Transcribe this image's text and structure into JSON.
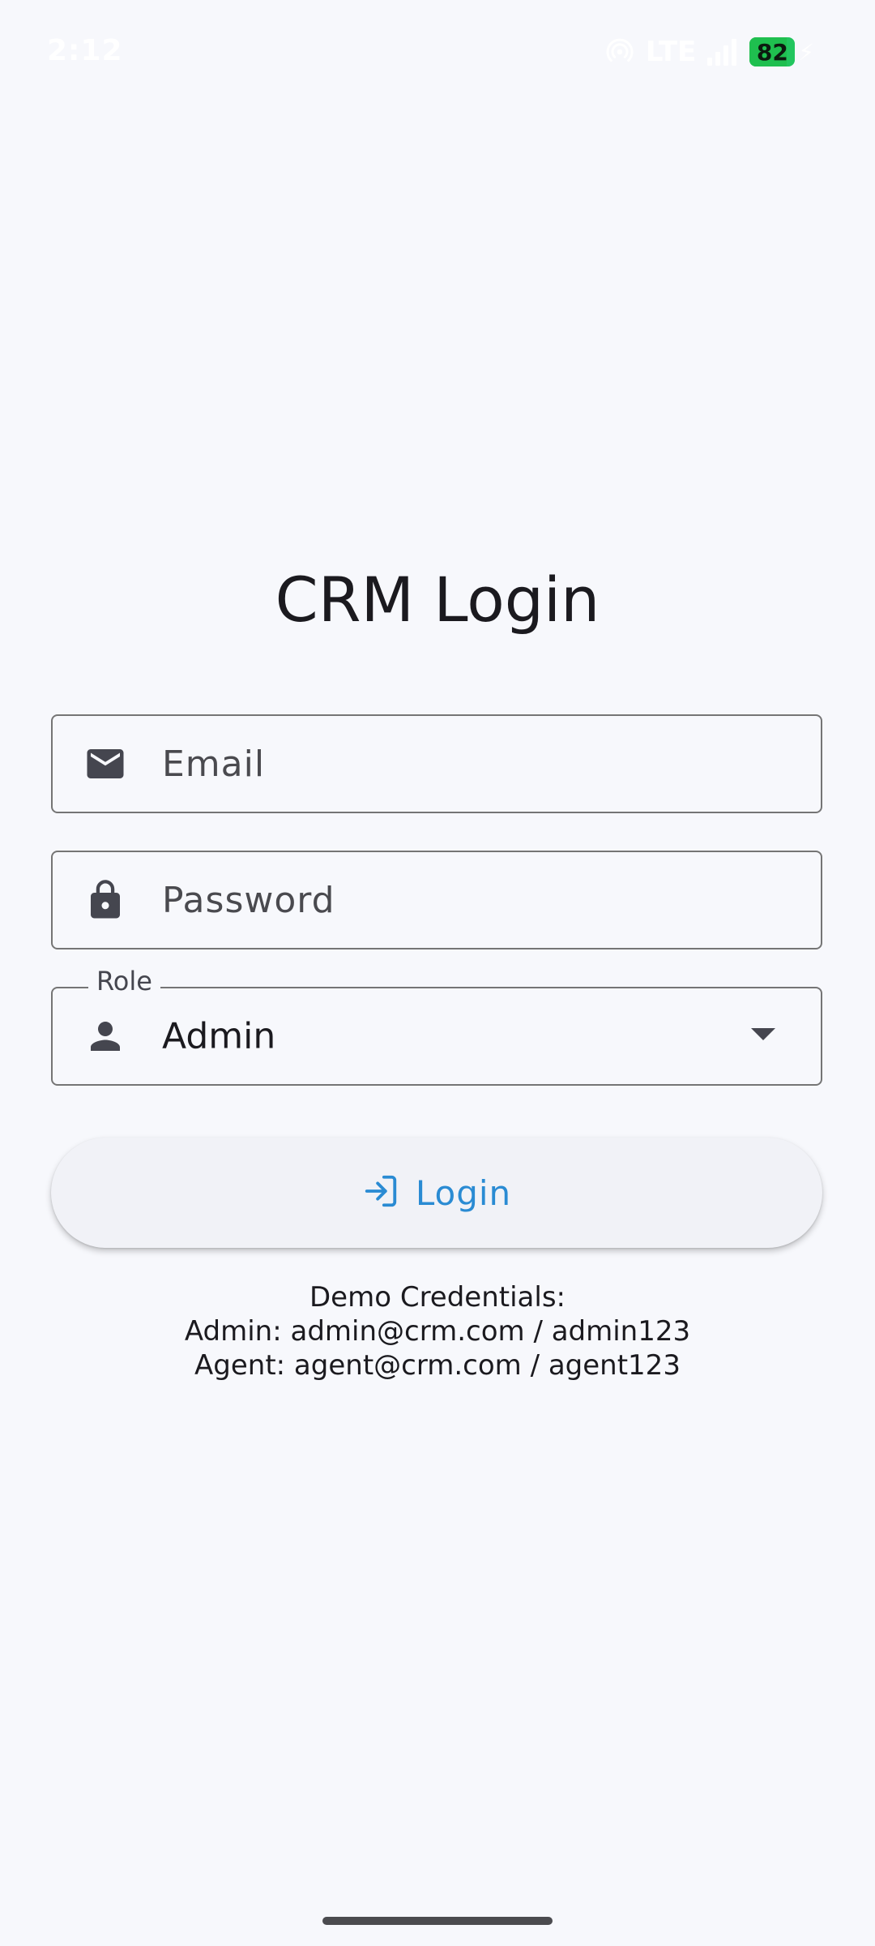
{
  "status_bar": {
    "time": "2:12",
    "network": "LTE",
    "battery_percent": "82"
  },
  "login": {
    "title": "CRM Login",
    "email_placeholder": "Email",
    "password_placeholder": "Password",
    "role_label": "Role",
    "role_value": "Admin",
    "login_button_label": "Login"
  },
  "demo": {
    "heading": "Demo Credentials:",
    "admin_line": "Admin: admin@crm.com / admin123",
    "agent_line": "Agent: agent@crm.com / agent123"
  },
  "icons": {
    "email": "email-icon",
    "password": "lock-icon",
    "role": "person-icon",
    "dropdown": "dropdown-arrow-icon",
    "login": "login-icon"
  },
  "colors": {
    "background": "#f7f8fc",
    "accent": "#2a8bd3",
    "battery": "#22c55e",
    "outline": "#757575"
  }
}
